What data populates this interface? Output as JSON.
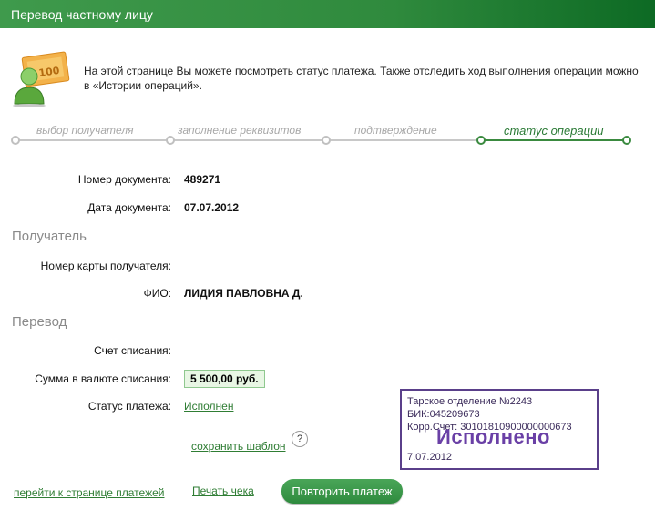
{
  "header": {
    "title": "Перевод частному лицу"
  },
  "intro": {
    "text": "На этой странице Вы можете посмотреть статус платежа. Также отследить ход выполнения операции можно в «Истории операций»."
  },
  "steps": [
    {
      "label": "выбор получателя",
      "active": false
    },
    {
      "label": "заполнение реквизитов",
      "active": false
    },
    {
      "label": "подтверждение",
      "active": false
    },
    {
      "label": "статус операции",
      "active": true
    }
  ],
  "document": {
    "number_label": "Номер документа:",
    "number_value": "489271",
    "date_label": "Дата документа:",
    "date_value": "07.07.2012"
  },
  "recipient": {
    "section_title": "Получатель",
    "card_label": "Номер карты получателя:",
    "card_value": "",
    "name_label": "ФИО:",
    "name_value": "ЛИДИЯ ПАВЛОВНА Д."
  },
  "transfer": {
    "section_title": "Перевод",
    "account_label": "Счет списания:",
    "account_value": "",
    "amount_label": "Сумма в валюте списания:",
    "amount_value": "5 500,00 руб.",
    "status_label": "Статус платежа:",
    "status_value": "Исполнен"
  },
  "actions": {
    "save_template": "сохранить шаблон",
    "help": "?",
    "back_to_payments": "перейти к странице платежей",
    "print_receipt": "Печать чека",
    "repeat_payment": "Повторить платеж"
  },
  "stamp": {
    "line1": "Тарское отделение №2243",
    "line2": "БИК:045209673",
    "line3": "Корр.Счет: 30101810900000000673",
    "status": "Исполнено",
    "date": "7.07.2012"
  },
  "colors": {
    "brand_green": "#2f8a3d",
    "stamp_purple": "#6a40a6"
  }
}
